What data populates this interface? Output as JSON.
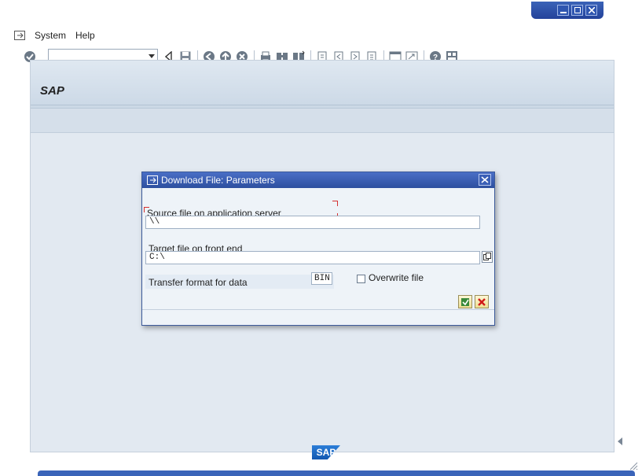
{
  "menu": {
    "system_label": "System",
    "help_label": "Help"
  },
  "toolbar": {
    "command_value": ""
  },
  "main": {
    "title": "SAP"
  },
  "dialog": {
    "title": "Download File: Parameters",
    "source_label": "Source file on application server",
    "source_value": "\\\\",
    "target_label": "Target file on front end",
    "target_value": "C:\\",
    "format_label": "Transfer format for data",
    "format_value": "BIN",
    "overwrite_label": "Overwrite file",
    "overwrite_checked": false
  },
  "footer": {
    "logo_text": "SAP"
  },
  "colors": {
    "title_bar": "#2d4f9f",
    "workspace": "#e2e9f1",
    "logo": "#1b6cc6"
  },
  "icons": [
    "menu-icon",
    "enter-icon",
    "save-icon",
    "back-icon",
    "exit-icon",
    "cancel-icon",
    "print-icon",
    "find-icon",
    "find-next-icon",
    "first-page-icon",
    "previous-page-icon",
    "next-page-icon",
    "last-page-icon",
    "create-session-icon",
    "shortcut-icon",
    "help-icon",
    "customize-icon"
  ]
}
